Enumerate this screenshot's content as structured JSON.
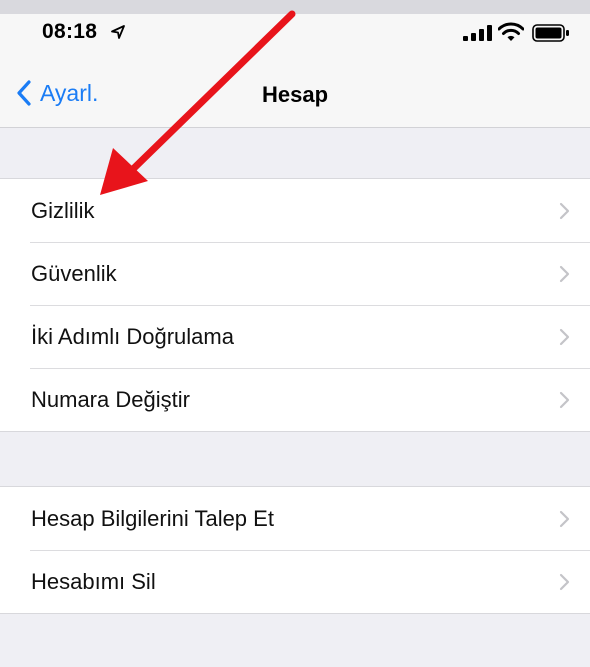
{
  "status_bar": {
    "time": "08:18",
    "icons": [
      "location-arrow-icon",
      "cellular-signal-icon",
      "wifi-icon",
      "battery-icon"
    ]
  },
  "nav": {
    "back_label": "Ayarl.",
    "title": "Hesap"
  },
  "groups": [
    {
      "items": [
        {
          "label": "Gizlilik"
        },
        {
          "label": "Güvenlik"
        },
        {
          "label": "İki Adımlı Doğrulama"
        },
        {
          "label": "Numara Değiştir"
        }
      ]
    },
    {
      "items": [
        {
          "label": "Hesap Bilgilerini Talep Et"
        },
        {
          "label": "Hesabımı Sil"
        }
      ]
    }
  ],
  "colors": {
    "accent": "#1a7cf5",
    "annotation_arrow": "#e8141b",
    "background": "#efeff4"
  }
}
